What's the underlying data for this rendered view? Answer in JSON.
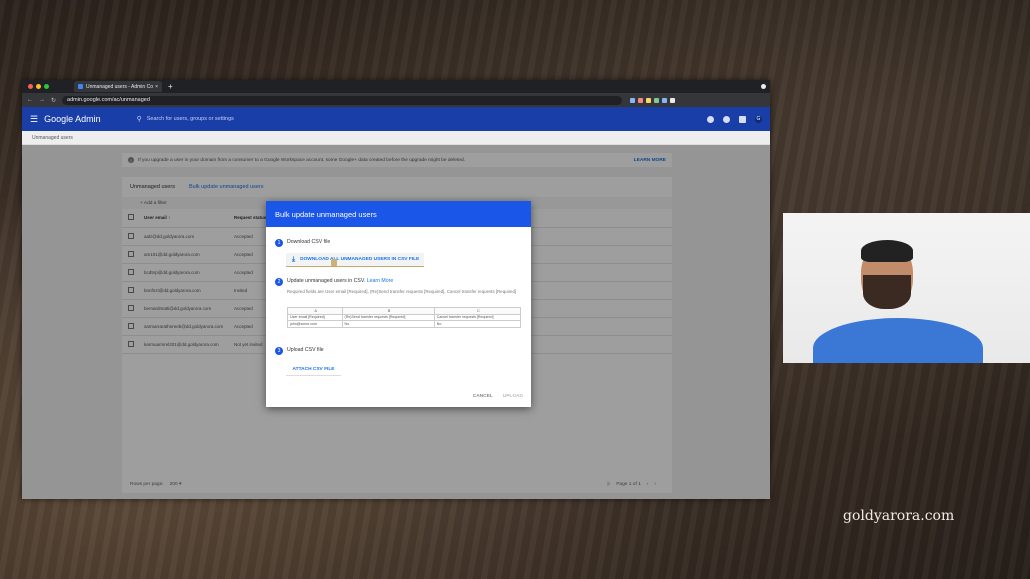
{
  "browser": {
    "tab_title": "Unmanaged users - Admin Co",
    "tab_close": "×",
    "new_tab": "+",
    "url": "admin.google.com/ac/unmanaged"
  },
  "admin": {
    "brand": "Google Admin",
    "search_placeholder": "Search for users, groups or settings",
    "avatar_letter": "G",
    "breadcrumb": "Unmanaged users",
    "notice_text": "If you upgrade a user in your domain from a consumer to a Google Workspace account, some Google+ data created before the upgrade might be deleted.",
    "notice_link": "LEARN MORE",
    "card_title": "Unmanaged users",
    "bulk_link": "Bulk update unmanaged users",
    "add_filter": "+ Add a filter",
    "col_email": "User email",
    "col_request": "Request status",
    "rows": [
      {
        "email": "aalz@dd.goldyarora.com",
        "status": "Accepted"
      },
      {
        "email": "am101@dd.goldyarora.com",
        "status": "Accepted"
      },
      {
        "email": "bcd5rp@dd.goldyarora.com",
        "status": "Accepted"
      },
      {
        "email": "bnnfnzt@dd.goldyarora.com",
        "status": "Invited"
      },
      {
        "email": "bernardmatti@dd.goldyarora.com",
        "status": "Accepted"
      },
      {
        "email": "sarmarrarathnreeb@dd.goldyarora.com",
        "status": "Accepted"
      },
      {
        "email": "karmuarmrel201@dd.goldyarora.com",
        "status": "Not yet invited"
      }
    ],
    "rows_per_page_label": "Rows per page:",
    "rows_per_page_value": "200",
    "page_info": "Page 1 of 1"
  },
  "dialog": {
    "title": "Bulk update unmanaged users",
    "step1_num": "1",
    "step1_title": "Download CSV file",
    "download_label": "DOWNLOAD ALL UNMANAGED USERS IN CSV FILE",
    "step2_num": "2",
    "step2_title": "Update unmanaged users in CSV.",
    "step2_link": "Learn More",
    "required_text": "Required fields are User email [Required], (Re)Send transfer requests [Required], Cancel transfer requests [Required]",
    "csv_columns": [
      "A",
      "B",
      "C"
    ],
    "csv_headers": [
      "User email [Required]",
      "(Re)Send transfer requests [Required]",
      "Cancel transfer requests [Required]"
    ],
    "csv_example": [
      "john@some.com",
      "No",
      "No"
    ],
    "step3_num": "3",
    "step3_title": "Upload CSV file",
    "attach_label": "ATTACH CSV FILE",
    "cancel_label": "CANCEL",
    "upload_label": "UPLOAD"
  },
  "watermark": "goldyarora.com"
}
